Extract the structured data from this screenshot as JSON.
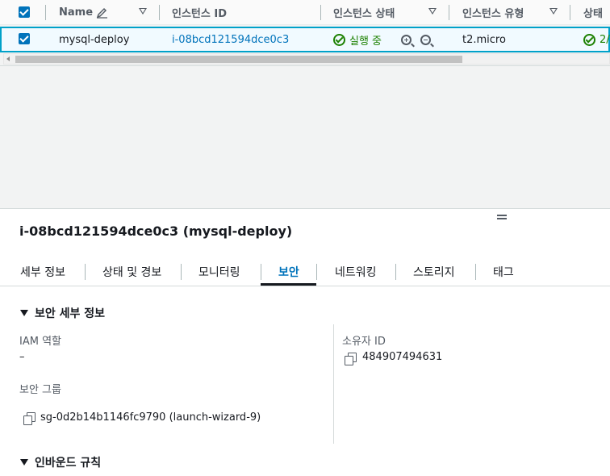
{
  "table": {
    "columns": [
      {
        "label": "Name",
        "icon": "pencil-icon"
      },
      {
        "label": "인스턴스 ID"
      },
      {
        "label": "인스턴스 상태"
      },
      {
        "label": "인스턴스 유형"
      },
      {
        "label": "상태"
      }
    ],
    "rows": [
      {
        "selected": true,
        "name": "mysql-deploy",
        "instance_id": "i-08bcd121594dce0c3",
        "instance_state": "실행 중",
        "instance_type": "t2.micro",
        "status_check": "2/"
      }
    ]
  },
  "details": {
    "title": "i-08bcd121594dce0c3 (mysql-deploy)",
    "tabs": [
      {
        "label": "세부 정보"
      },
      {
        "label": "상태 및 경보"
      },
      {
        "label": "모니터링"
      },
      {
        "label": "보안",
        "active": true
      },
      {
        "label": "네트워킹"
      },
      {
        "label": "스토리지"
      },
      {
        "label": "태그"
      }
    ],
    "security_section_title": "보안 세부 정보",
    "iam_role_label": "IAM 역할",
    "iam_role_value": "–",
    "owner_id_label": "소유자 ID",
    "owner_id_value": "484907494631",
    "security_groups_label": "보안 그룹",
    "security_group_link": "sg-0d2b14b1146fc9790 (launch-wizard-9)",
    "inbound_rules_title": "인바운드 규칙"
  },
  "colors": {
    "link": "#0073bb",
    "success": "#1d8102",
    "selected_row_border": "#00a1c9",
    "selected_row_bg": "#f1faff"
  }
}
